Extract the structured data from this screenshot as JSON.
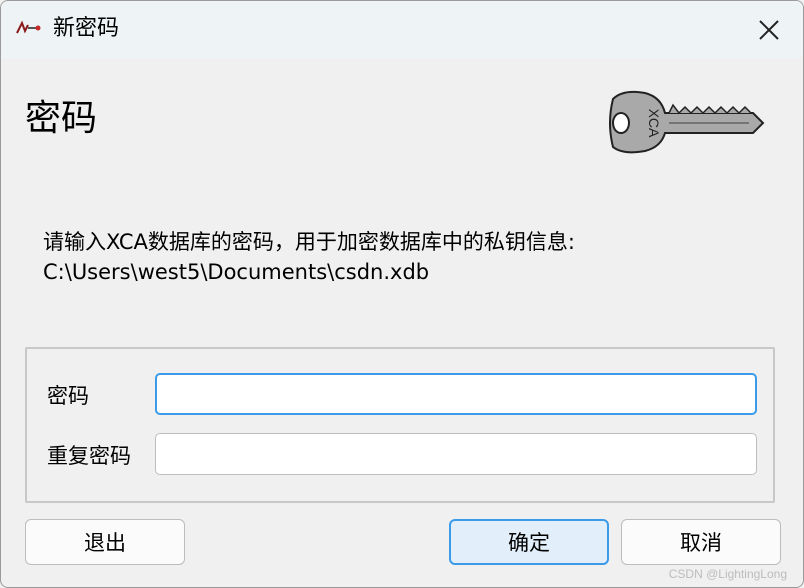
{
  "window": {
    "title": "新密码",
    "icons": {
      "app": "xca-app-icon",
      "close": "close-icon",
      "key": "key-icon"
    }
  },
  "header": {
    "heading": "密码",
    "key_image_text": "XCA"
  },
  "description": {
    "line1": "请输入XCA数据库的密码，用于加密数据库中的私钥信息:",
    "line2": "C:\\Users\\west5\\Documents\\csdn.xdb"
  },
  "form": {
    "password_label": "密码",
    "password_value": "",
    "repeat_label": "重复密码",
    "repeat_value": ""
  },
  "buttons": {
    "exit": "退出",
    "ok": "确定",
    "cancel": "取消"
  },
  "watermark": "CSDN @LightingLong",
  "colors": {
    "focus": "#3c9be8",
    "titlebar": "#eef4f6",
    "background": "#f0f0f0"
  }
}
